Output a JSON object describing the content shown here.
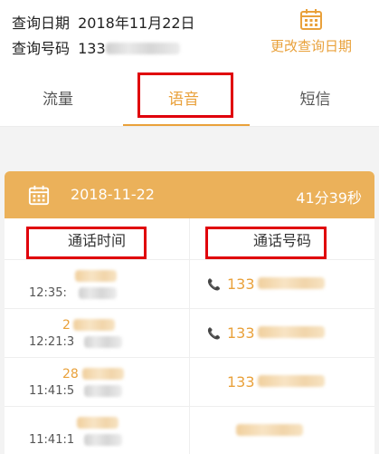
{
  "header": {
    "query_date_label": "查询日期",
    "query_date_value": "2018年11月22日",
    "query_number_label": "查询号码",
    "query_number_value": "133",
    "change_date_label": "更改查询日期",
    "calendar_icon": "calendar-icon"
  },
  "tabs": [
    {
      "label": "流量",
      "active": false
    },
    {
      "label": "语音",
      "active": true
    },
    {
      "label": "短信",
      "active": false
    }
  ],
  "summary": {
    "date": "2018-11-22",
    "total_duration": "41分39秒"
  },
  "columns": {
    "time": "通话时间",
    "number": "通话号码"
  },
  "records": [
    {
      "date_text": "",
      "time_text": "12:35:",
      "number_text": "133",
      "has_phone_icon": true
    },
    {
      "date_text": "2",
      "time_text": "12:21:3",
      "number_text": "133",
      "has_phone_icon": true
    },
    {
      "date_text": "28",
      "time_text": "11:41:5",
      "number_text": "133",
      "has_phone_icon": false
    },
    {
      "date_text": "",
      "time_text": "11:41:1",
      "number_text": "",
      "has_phone_icon": false
    }
  ],
  "colors": {
    "accent": "#e9a13b",
    "summary_bar": "#ebb15a",
    "highlight_box": "#e0000b"
  }
}
